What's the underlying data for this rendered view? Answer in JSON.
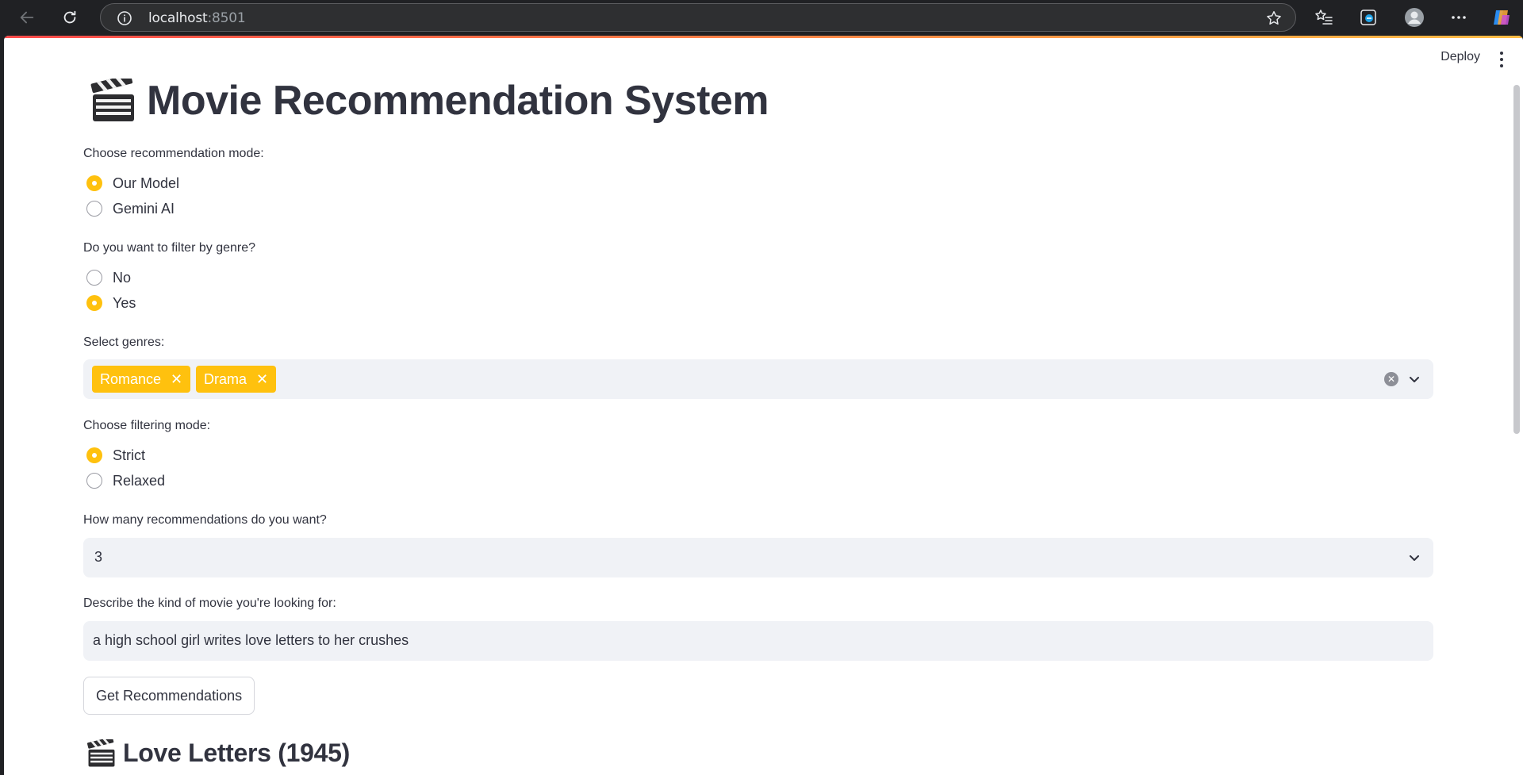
{
  "browser": {
    "url_host": "localhost",
    "url_port": ":8501"
  },
  "app": {
    "deploy_label": "Deploy",
    "title": "Movie Recommendation System",
    "title_icon": "clapper-board-icon"
  },
  "mode": {
    "label": "Choose recommendation mode:",
    "options": [
      "Our Model",
      "Gemini AI"
    ],
    "selected": "Our Model"
  },
  "genre_filter": {
    "label": "Do you want to filter by genre?",
    "options": [
      "No",
      "Yes"
    ],
    "selected": "Yes"
  },
  "genres": {
    "label": "Select genres:",
    "selected": [
      "Romance",
      "Drama"
    ],
    "chip_color": "#ffc10e"
  },
  "filtering": {
    "label": "Choose filtering mode:",
    "options": [
      "Strict",
      "Relaxed"
    ],
    "selected": "Strict"
  },
  "count": {
    "label": "How many recommendations do you want?",
    "value": "3"
  },
  "description": {
    "label": "Describe the kind of movie you're looking for:",
    "value": "a high school girl writes love letters to her crushes"
  },
  "submit": {
    "label": "Get Recommendations"
  },
  "result": {
    "title": "Love Letters (1945)",
    "icon": "clapper-board-icon"
  },
  "colors": {
    "accent": "#ffc10e",
    "text": "#31333f",
    "input_bg": "#f0f2f6"
  }
}
